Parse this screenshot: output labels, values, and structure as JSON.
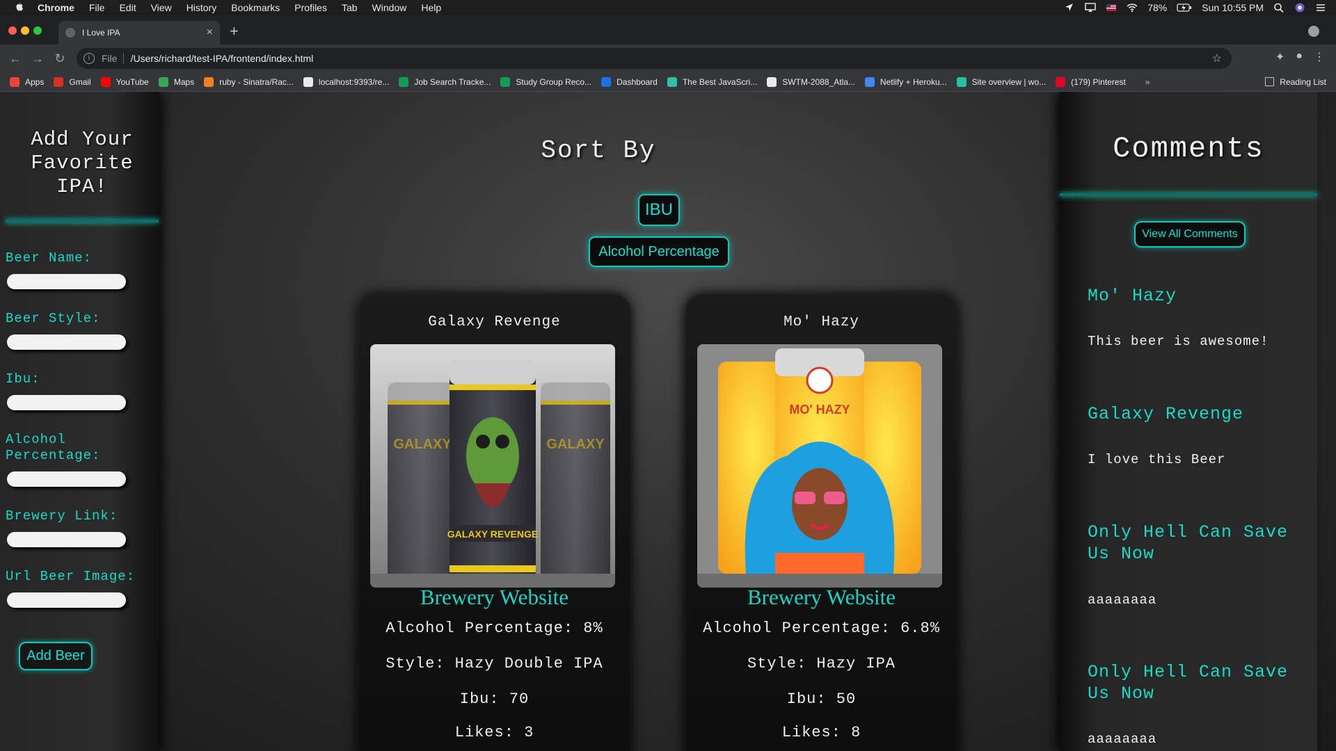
{
  "menubar": {
    "app": "Chrome",
    "items": [
      "File",
      "Edit",
      "View",
      "History",
      "Bookmarks",
      "Profiles",
      "Tab",
      "Window",
      "Help"
    ],
    "battery": "78%",
    "clock": "Sun 10:55 PM"
  },
  "browser": {
    "tab_title": "I Love IPA",
    "scheme": "File",
    "url": "/Users/richard/test-IPA/frontend/index.html",
    "bookmarks": [
      {
        "label": "Apps",
        "color": "#e8453c"
      },
      {
        "label": "Gmail",
        "color": "#d93025"
      },
      {
        "label": "YouTube",
        "color": "#ff0000"
      },
      {
        "label": "Maps",
        "color": "#34a853"
      },
      {
        "label": "ruby - Sinatra/Rac...",
        "color": "#f48024"
      },
      {
        "label": "localhost:9393/re...",
        "color": "#e8eaed"
      },
      {
        "label": "Job Search Tracke...",
        "color": "#0f9d58"
      },
      {
        "label": "Study Group Reco...",
        "color": "#0f9d58"
      },
      {
        "label": "Dashboard",
        "color": "#1a73e8"
      },
      {
        "label": "The Best JavaScri...",
        "color": "#2fc1a6"
      },
      {
        "label": "SWTM-2088_Atla...",
        "color": "#e8eaed"
      },
      {
        "label": "Netlify + Heroku...",
        "color": "#4285f4"
      },
      {
        "label": "Site overview | wo...",
        "color": "#25c2a0"
      },
      {
        "label": "(179) Pinterest",
        "color": "#e60023"
      }
    ],
    "reading_list": "Reading List"
  },
  "form": {
    "title": "Add Your Favorite IPA!",
    "fields": [
      {
        "label": "Beer Name:"
      },
      {
        "label": "Beer Style:"
      },
      {
        "label": "Ibu:"
      },
      {
        "label": "Alcohol Percentage:"
      },
      {
        "label": "Brewery Link:"
      },
      {
        "label": "Url Beer Image:"
      }
    ],
    "submit": "Add Beer"
  },
  "sort": {
    "title": "Sort By",
    "ibu": "IBU",
    "alcohol": "Alcohol Percentage"
  },
  "beers": [
    {
      "name": "Galaxy Revenge",
      "link": "Brewery Website",
      "alcohol": "Alcohol Percentage: 8%",
      "style": "Style: Hazy Double IPA",
      "ibu": "Ibu: 70",
      "likes": "Likes: 3"
    },
    {
      "name": "Mo' Hazy",
      "link": "Brewery Website",
      "alcohol": "Alcohol Percentage: 6.8%",
      "style": "Style: Hazy IPA",
      "ibu": "Ibu: 50",
      "likes": "Likes: 8"
    }
  ],
  "comments": {
    "title": "Comments",
    "view_all": "View All Comments",
    "items": [
      {
        "beer": "Mo' Hazy",
        "text": "This beer is awesome!"
      },
      {
        "beer": "Galaxy Revenge",
        "text": "I love this Beer"
      },
      {
        "beer": "Only Hell Can Save Us Now",
        "text": "aaaaaaaa"
      },
      {
        "beer": "Only Hell Can Save Us Now",
        "text": "aaaaaaaa"
      }
    ]
  },
  "colors": {
    "accent": "#0fe0d0"
  }
}
